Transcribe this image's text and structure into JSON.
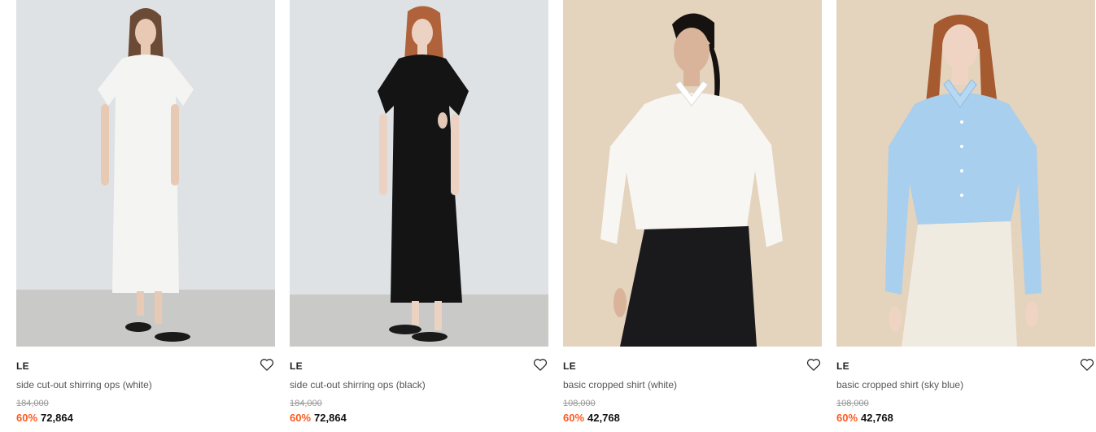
{
  "products": [
    {
      "brand": "LE",
      "name": "side cut-out shirring ops (white)",
      "original_price": "184,000",
      "discount": "60%",
      "sale_price": "72,864"
    },
    {
      "brand": "LE",
      "name": "side cut-out shirring ops (black)",
      "original_price": "184,000",
      "discount": "60%",
      "sale_price": "72,864"
    },
    {
      "brand": "LE",
      "name": "basic cropped shirt (white)",
      "original_price": "108,000",
      "discount": "60%",
      "sale_price": "42,768"
    },
    {
      "brand": "LE",
      "name": "basic cropped shirt (sky blue)",
      "original_price": "108,000",
      "discount": "60%",
      "sale_price": "42,768"
    }
  ],
  "colors": {
    "discount": "#ff5a1f",
    "studio_wall": "#dfe2e4",
    "studio_floor": "#c9c9c7",
    "beige_wall": "#e4d3bd"
  },
  "icons": {
    "wishlist": "heart-outline-icon"
  }
}
